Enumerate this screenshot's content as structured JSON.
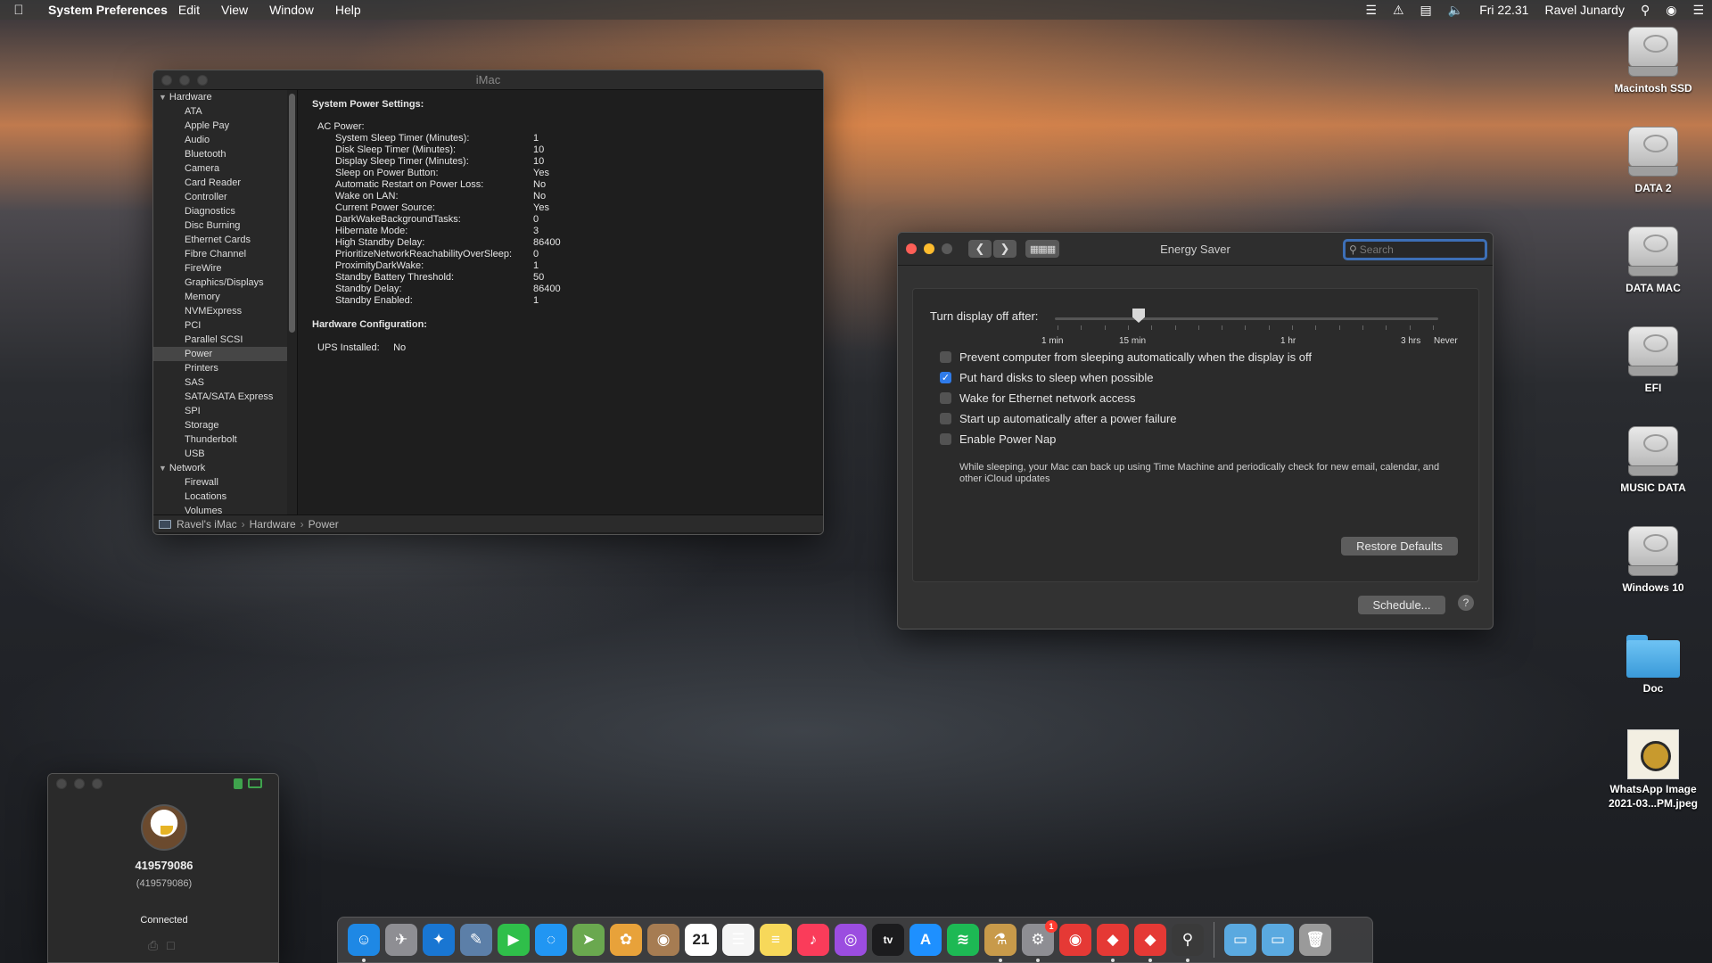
{
  "menubar": {
    "app_name": "System Preferences",
    "menus": [
      "Edit",
      "View",
      "Window",
      "Help"
    ],
    "status_text": "Fri 22.31",
    "user_name": "Ravel Junardy"
  },
  "sysinfo": {
    "title": "iMac",
    "sidebar": {
      "hardware_label": "Hardware",
      "hardware_items": [
        "ATA",
        "Apple Pay",
        "Audio",
        "Bluetooth",
        "Camera",
        "Card Reader",
        "Controller",
        "Diagnostics",
        "Disc Burning",
        "Ethernet Cards",
        "Fibre Channel",
        "FireWire",
        "Graphics/Displays",
        "Memory",
        "NVMExpress",
        "PCI",
        "Parallel SCSI",
        "Power",
        "Printers",
        "SAS",
        "SATA/SATA Express",
        "SPI",
        "Storage",
        "Thunderbolt",
        "USB"
      ],
      "selected": "Power",
      "network_label": "Network",
      "network_items": [
        "Firewall",
        "Locations",
        "Volumes"
      ]
    },
    "content": {
      "section_title": "System Power Settings:",
      "ac_power_label": "AC Power:",
      "rows": [
        {
          "k": "System Sleep Timer (Minutes):",
          "v": "1"
        },
        {
          "k": "Disk Sleep Timer (Minutes):",
          "v": "10"
        },
        {
          "k": "Display Sleep Timer (Minutes):",
          "v": "10"
        },
        {
          "k": "Sleep on Power Button:",
          "v": "Yes"
        },
        {
          "k": "Automatic Restart on Power Loss:",
          "v": "No"
        },
        {
          "k": "Wake on LAN:",
          "v": "No"
        },
        {
          "k": "Current Power Source:",
          "v": "Yes"
        },
        {
          "k": "DarkWakeBackgroundTasks:",
          "v": "0"
        },
        {
          "k": "Hibernate Mode:",
          "v": "3"
        },
        {
          "k": "High Standby Delay:",
          "v": "86400"
        },
        {
          "k": "PrioritizeNetworkReachabilityOverSleep:",
          "v": "0"
        },
        {
          "k": "ProximityDarkWake:",
          "v": "1"
        },
        {
          "k": "Standby Battery Threshold:",
          "v": "50"
        },
        {
          "k": "Standby Delay:",
          "v": "86400"
        },
        {
          "k": "Standby Enabled:",
          "v": "1"
        }
      ],
      "hw_title": "Hardware Configuration:",
      "ups_label": "UPS Installed:",
      "ups_value": "No"
    },
    "pathbar": [
      "Ravel's iMac",
      "Hardware",
      "Power"
    ]
  },
  "energy": {
    "title": "Energy Saver",
    "search_placeholder": "Search",
    "slider_label": "Turn display off after:",
    "slider_value": "10 min",
    "tick_labels": [
      "1 min",
      "15 min",
      "1 hr",
      "3 hrs",
      "Never"
    ],
    "options": [
      {
        "label": "Prevent computer from sleeping automatically when the display is off",
        "checked": false
      },
      {
        "label": "Put hard disks to sleep when possible",
        "checked": true
      },
      {
        "label": "Wake for Ethernet network access",
        "checked": false
      },
      {
        "label": "Start up automatically after a power failure",
        "checked": false
      },
      {
        "label": "Enable Power Nap",
        "checked": false
      }
    ],
    "power_nap_note": "While sleeping, your Mac can back up using Time Machine and periodically check for new email, calendar, and other iCloud updates",
    "restore_label": "Restore Defaults",
    "schedule_label": "Schedule...",
    "help_label": "?"
  },
  "contact": {
    "id": "419579086",
    "id_sub": "(419579086)",
    "status": "Connected"
  },
  "desktop": {
    "icons": [
      {
        "label": "Macintosh SSD",
        "kind": "drive"
      },
      {
        "label": "DATA 2",
        "kind": "drive"
      },
      {
        "label": "DATA MAC",
        "kind": "drive"
      },
      {
        "label": "EFI",
        "kind": "drive"
      },
      {
        "label": "MUSIC DATA",
        "kind": "drive"
      },
      {
        "label": "Windows 10",
        "kind": "drive"
      },
      {
        "label": "Doc",
        "kind": "folder"
      },
      {
        "label": "WhatsApp Image 2021-03...PM.jpeg",
        "kind": "image"
      }
    ]
  },
  "dock": {
    "calendar_day": "21",
    "settings_badge": "1",
    "tv_label": "tv",
    "apps": [
      {
        "name": "finder-icon",
        "color": "#1e88e5",
        "glyph": "☺",
        "running": true
      },
      {
        "name": "launchpad-icon",
        "color": "#8e8e93",
        "glyph": "✈",
        "running": false
      },
      {
        "name": "safari-icon",
        "color": "#1976d2",
        "glyph": "✦",
        "running": false
      },
      {
        "name": "preview-icon",
        "color": "#5c7fa8",
        "glyph": "✎",
        "running": false
      },
      {
        "name": "facetime-icon",
        "color": "#2fbf4a",
        "glyph": "▶",
        "running": false
      },
      {
        "name": "messages-icon",
        "color": "#2196f3",
        "glyph": "◌",
        "running": false
      },
      {
        "name": "maps-icon",
        "color": "#6aa84f",
        "glyph": "➤",
        "running": false
      },
      {
        "name": "photos-icon",
        "color": "#e8a23a",
        "glyph": "✿",
        "running": false
      },
      {
        "name": "contacts-icon",
        "color": "#a67c52",
        "glyph": "◉",
        "running": false
      },
      {
        "name": "calendar-icon",
        "color": "#ffffff",
        "glyph": "",
        "running": false
      },
      {
        "name": "reminders-icon",
        "color": "#f5f5f5",
        "glyph": "☰",
        "running": false
      },
      {
        "name": "notes-icon",
        "color": "#f7d85a",
        "glyph": "≡",
        "running": false
      },
      {
        "name": "music-icon",
        "color": "#fa3c5a",
        "glyph": "♪",
        "running": false
      },
      {
        "name": "podcasts-icon",
        "color": "#9b4de0",
        "glyph": "◎",
        "running": false
      },
      {
        "name": "tv-icon",
        "color": "#1c1c1e",
        "glyph": "",
        "running": false
      },
      {
        "name": "app-store-icon",
        "color": "#1e90ff",
        "glyph": "A",
        "running": false
      },
      {
        "name": "spotify-icon",
        "color": "#1db954",
        "glyph": "≋",
        "running": false
      },
      {
        "name": "script-editor-icon",
        "color": "#c89a4a",
        "glyph": "⚗",
        "running": true
      },
      {
        "name": "system-preferences-icon",
        "color": "#8e8e93",
        "glyph": "⚙",
        "running": true
      },
      {
        "name": "chrome-icon",
        "color": "#e53935",
        "glyph": "◉",
        "running": false
      },
      {
        "name": "anydesk-icon",
        "color": "#e53935",
        "glyph": "◆",
        "running": true
      },
      {
        "name": "anydesk-alt-icon",
        "color": "#e53935",
        "glyph": "◆",
        "running": true
      },
      {
        "name": "hackintool-icon",
        "color": "#3a3a3a",
        "glyph": "⚲",
        "running": true
      }
    ],
    "folders": [
      {
        "name": "applications-folder-icon",
        "color": "#5aa9e0"
      },
      {
        "name": "downloads-folder-icon",
        "color": "#5aa9e0"
      },
      {
        "name": "trash-icon",
        "color": "#9a9a9a"
      }
    ]
  }
}
